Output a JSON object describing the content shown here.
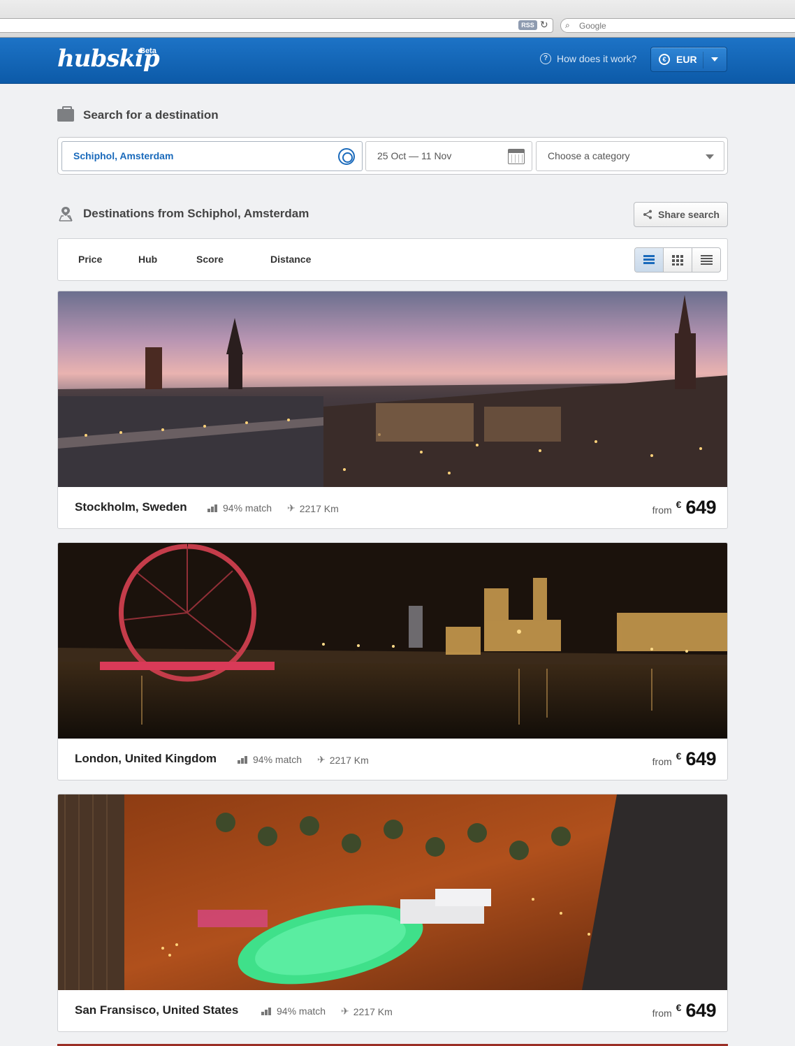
{
  "browser": {
    "rss_label": "RSS",
    "search_placeholder": "Google"
  },
  "header": {
    "logo": "hubskip",
    "beta": "Beta",
    "help_link": "How does it work?",
    "currency": "EUR"
  },
  "search": {
    "heading": "Search for a destination",
    "origin_value": "Schiphol, Amsterdam",
    "dates_value": "25 Oct — 11 Nov",
    "category_placeholder": "Choose a category"
  },
  "results": {
    "heading": "Destinations from Schiphol, Amsterdam",
    "share_label": "Share search",
    "sort_options": [
      "Price",
      "Hub",
      "Score",
      "Distance"
    ]
  },
  "destinations": [
    {
      "city": "Stockholm, Sweden",
      "match": "94% match",
      "distance": "2217 Km",
      "from_label": "from",
      "currency_symbol": "€",
      "price": "649"
    },
    {
      "city": "London, United Kingdom",
      "match": "94% match",
      "distance": "2217 Km",
      "from_label": "from",
      "currency_symbol": "€",
      "price": "649"
    },
    {
      "city": "San Fransisco, United States",
      "match": "94% match",
      "distance": "2217 Km",
      "from_label": "from",
      "currency_symbol": "€",
      "price": "649"
    }
  ],
  "colors": {
    "brand_blue": "#1a6abb",
    "page_bg": "#f0f1f3"
  }
}
